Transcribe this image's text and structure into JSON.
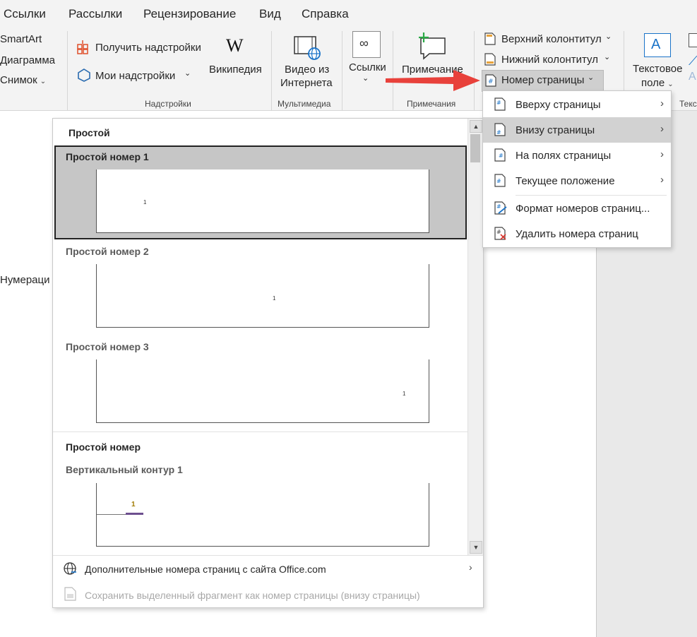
{
  "menu_tabs": [
    "Ссылки",
    "Рассылки",
    "Рецензирование",
    "Вид",
    "Справка"
  ],
  "ribbon": {
    "illustrations": {
      "smartart": "SmartArt",
      "chart": "Диаграмма",
      "screenshot": "Снимок"
    },
    "addins": {
      "get_addins": "Получить надстройки",
      "my_addins": "Мои надстройки",
      "wikipedia": "Википедия",
      "group_label": "Надстройки"
    },
    "media": {
      "online_video_line1": "Видео из",
      "online_video_line2": "Интернета",
      "group_label": "Мультимедиа"
    },
    "links": {
      "label": "Ссылки"
    },
    "comments": {
      "comment": "Примечание",
      "group_label": "Примечания"
    },
    "header_footer": {
      "header": "Верхний колонтитул",
      "footer": "Нижний колонтитул",
      "page_number": "Номер страницы"
    },
    "text": {
      "textbox_line1": "Текстовое",
      "textbox_line2": "поле",
      "group_label_partial": "Текс"
    }
  },
  "document": {
    "visible_text": "Нумераци"
  },
  "page_number_menu": {
    "items": [
      {
        "label": "Вверху страницы",
        "submenu": true,
        "icon": "page-number-top-icon"
      },
      {
        "label": "Внизу страницы",
        "submenu": true,
        "highlighted": true,
        "icon": "page-number-bottom-icon"
      },
      {
        "label": "На полях страницы",
        "submenu": true,
        "icon": "page-number-margin-icon"
      },
      {
        "label": "Текущее положение",
        "submenu": true,
        "icon": "page-number-current-icon"
      },
      {
        "label": "Формат номеров страниц...",
        "submenu": false,
        "icon": "format-page-numbers-icon"
      },
      {
        "label": "Удалить номера страниц",
        "submenu": false,
        "icon": "remove-page-numbers-icon"
      }
    ]
  },
  "gallery": {
    "section1_title": "Простой",
    "entries": [
      {
        "title": "Простой номер 1",
        "number": "1",
        "selected": true
      },
      {
        "title": "Простой номер 2",
        "number": "1"
      },
      {
        "title": "Простой номер 3",
        "number": "1"
      }
    ],
    "section2_title": "Простой номер",
    "vertical_title": "Вертикальный контур 1",
    "vertical_number": "1",
    "footer": {
      "more": "Дополнительные номера страниц с сайта Office.com",
      "save": "Сохранить выделенный фрагмент как номер страницы (внизу страницы)"
    }
  },
  "colors": {
    "accent_arrow": "#e8413b",
    "menu_highlight": "#d2d2d2",
    "gallery_selected": "#c6c6c6",
    "vertical_number_fill": "#a07a00",
    "vertical_bar": "#6d4f8f"
  }
}
